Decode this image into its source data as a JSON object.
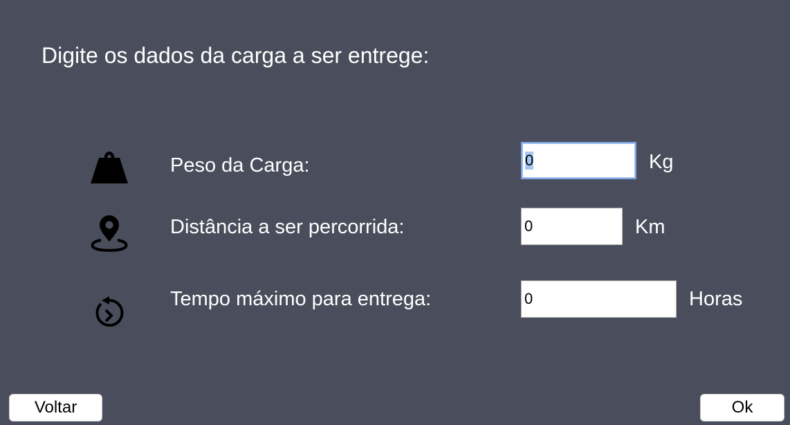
{
  "header": {
    "title": "Digite os dados da carga a ser entrege:"
  },
  "form": {
    "rows": [
      {
        "icon": "weight-icon",
        "label": "Peso da Carga:",
        "value": "0",
        "unit": "Kg",
        "focused": true
      },
      {
        "icon": "map-pin-icon",
        "label": "Distância a ser percorrida:",
        "value": "0",
        "unit": "Km",
        "focused": false
      },
      {
        "icon": "timer-icon",
        "label": "Tempo máximo para entrega:",
        "value": "0",
        "unit": "Horas",
        "focused": false
      }
    ]
  },
  "footer": {
    "back_label": "Voltar",
    "ok_label": "Ok"
  },
  "colors": {
    "background": "#4a4e5c",
    "text": "#ffffff",
    "focus_ring": "#7ea7e0"
  }
}
